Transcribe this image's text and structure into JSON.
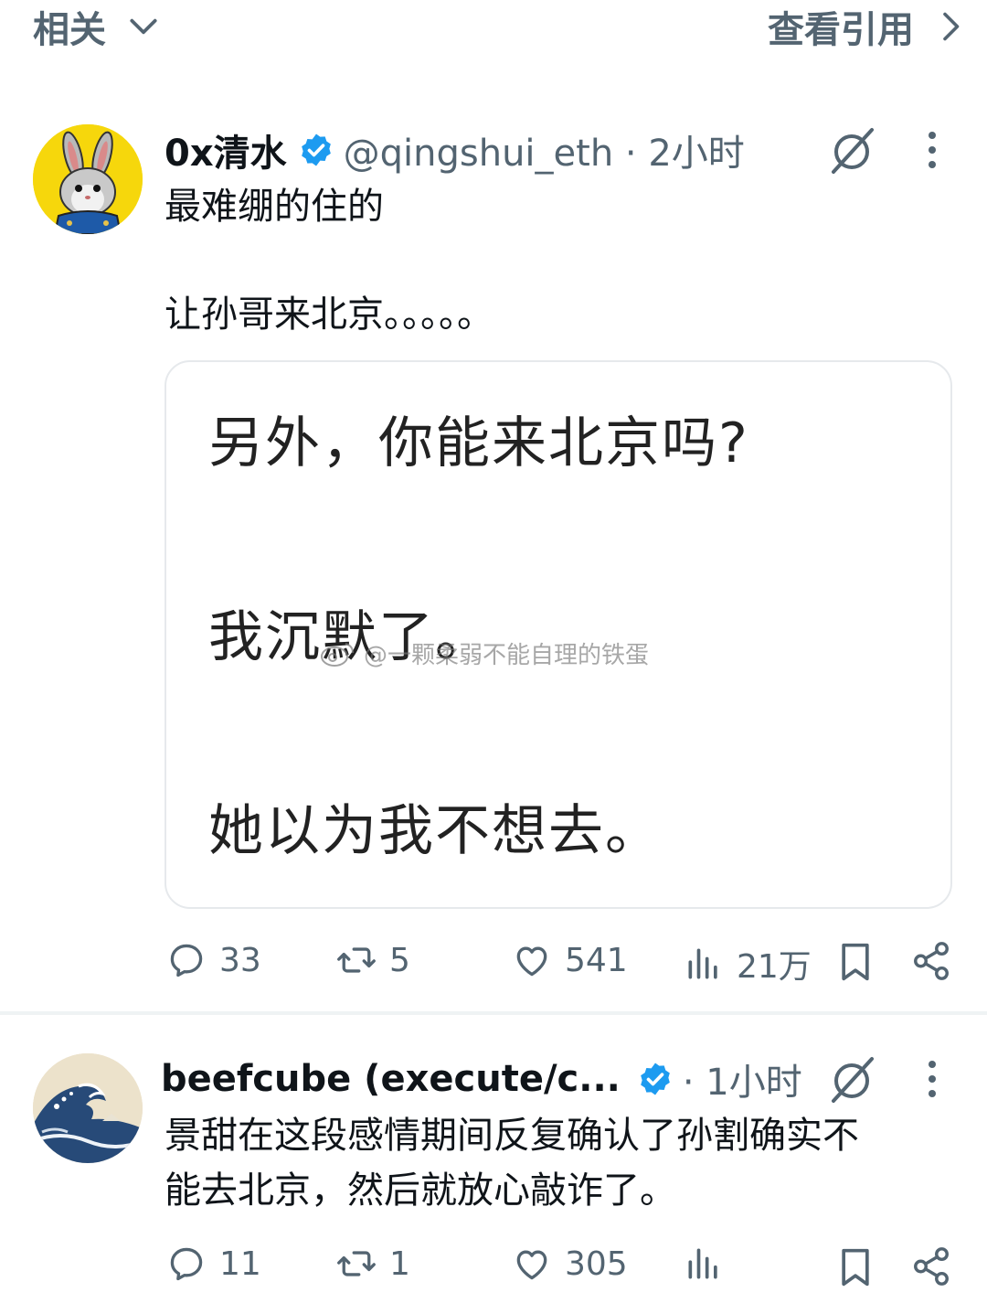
{
  "top_bar": {
    "left_label": "相关",
    "right_label": "查看引用"
  },
  "tweet1": {
    "author_name": "0x清水",
    "handle_time": "@qingshui_eth · 2小时",
    "text_line1": "最难绷的住的",
    "text_line2": "让孙哥来北京。。。。。",
    "image_text": {
      "line1": "另外，你能来北京吗?",
      "line2": "我沉默了。",
      "line3": "她以为我不想去。",
      "watermark": "@一颗柔弱不能自理的铁蛋"
    },
    "stats": {
      "replies": "33",
      "reposts": "5",
      "likes": "541",
      "views": "21万"
    }
  },
  "tweet2": {
    "author_name": "beefcube (execute/c...",
    "time": "· 1小时",
    "text_line1": "景甜在这段感情期间反复确认了孙割确实不",
    "text_line2": "能去北京，然后就放心敲诈了。",
    "stats": {
      "replies": "11",
      "reposts": "1",
      "likes": "305"
    }
  },
  "colors": {
    "verified": "#1d9bf0",
    "muted": "#536471",
    "text": "#0f1419"
  },
  "icons": [
    "chevron-down-icon",
    "chevron-right-icon",
    "verified-icon",
    "grok-icon",
    "more-icon",
    "reply-icon",
    "repost-icon",
    "like-icon",
    "views-icon",
    "bookmark-icon",
    "share-icon"
  ]
}
